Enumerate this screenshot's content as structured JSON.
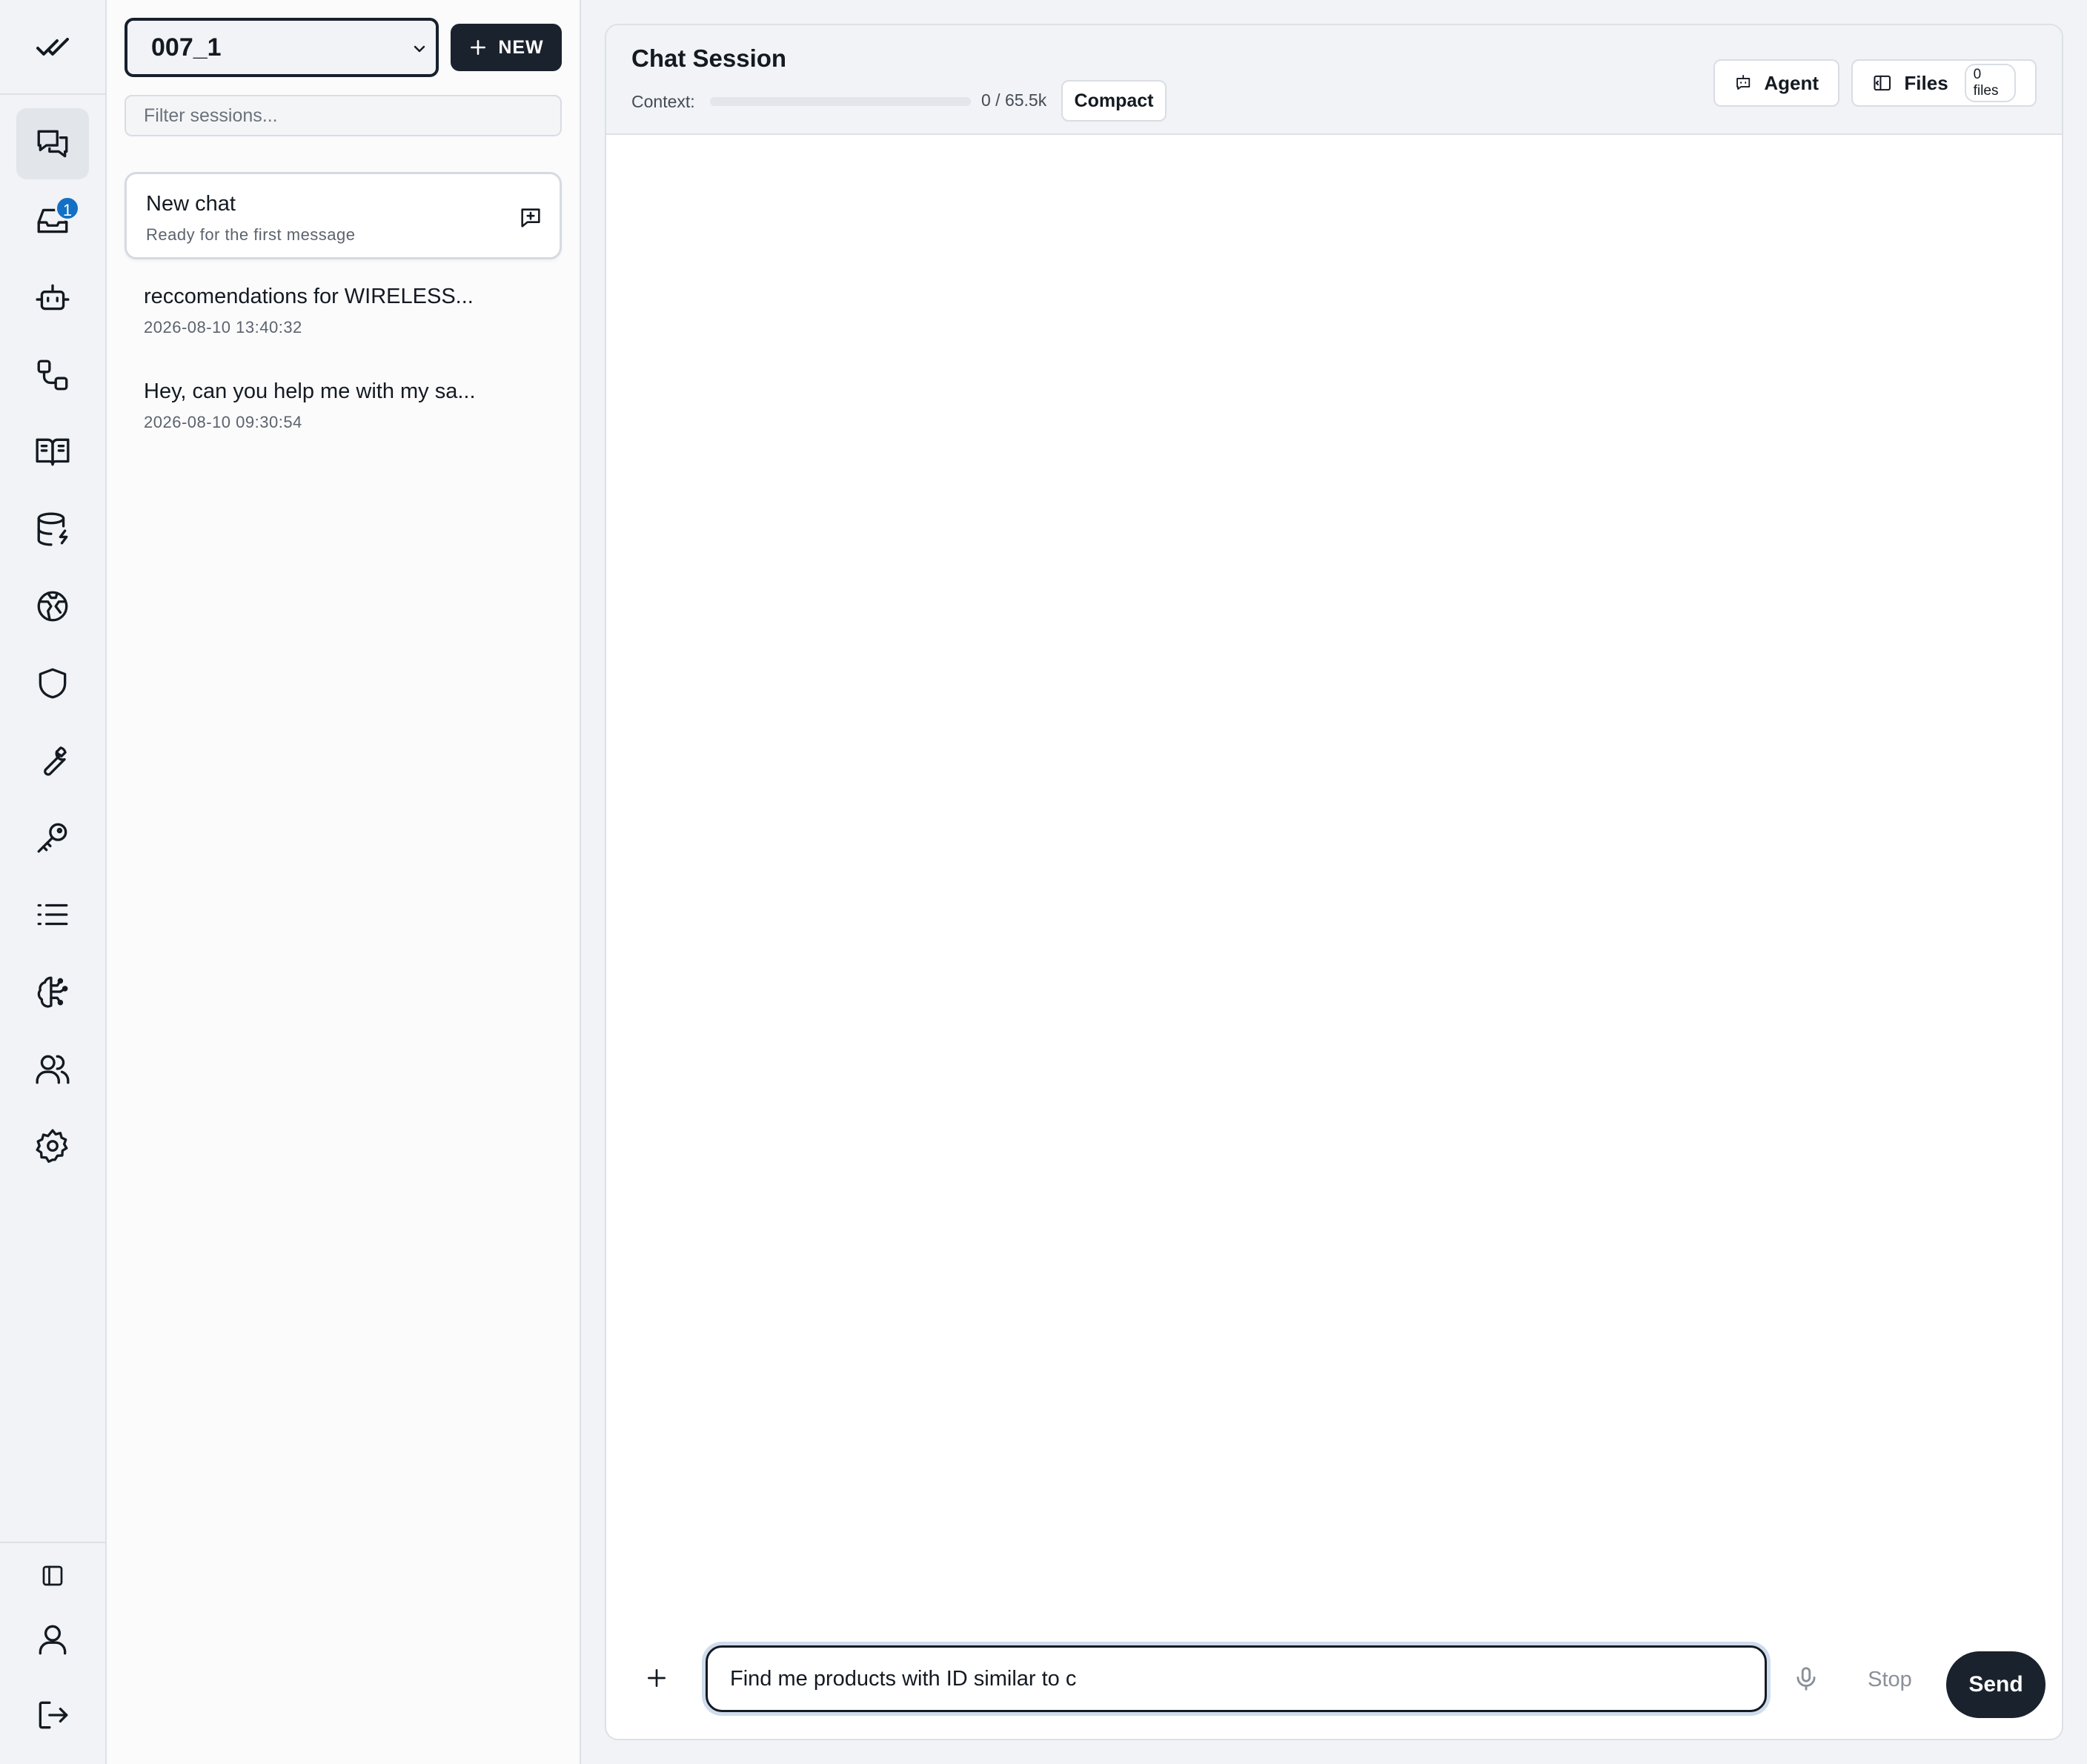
{
  "rail": {
    "logo": "double-check-icon",
    "items": [
      {
        "name": "chat-icon",
        "active": true
      },
      {
        "name": "inbox-icon",
        "badge": "1"
      },
      {
        "name": "bot-icon"
      },
      {
        "name": "workflow-icon"
      },
      {
        "name": "book-icon"
      },
      {
        "name": "database-icon"
      },
      {
        "name": "globe-icon"
      },
      {
        "name": "shield-icon"
      },
      {
        "name": "wrench-icon"
      },
      {
        "name": "key-icon"
      },
      {
        "name": "list-icon"
      },
      {
        "name": "brain-icon"
      },
      {
        "name": "users-icon"
      },
      {
        "name": "gear-icon"
      }
    ],
    "bottom": [
      "sidebar-toggle-icon",
      "user-icon",
      "logout-icon"
    ]
  },
  "sessions": {
    "workspace": "007_1",
    "new_label": "NEW",
    "filter_placeholder": "Filter sessions...",
    "items": [
      {
        "title": "New chat",
        "subtitle": "Ready for the first message",
        "active": true
      },
      {
        "title": "reccomendations for WIRELESS...",
        "subtitle": "2026-08-10 13:40:32"
      },
      {
        "title": "Hey, can you help me with my sa...",
        "subtitle": "2026-08-10 09:30:54"
      }
    ]
  },
  "chat": {
    "title": "Chat Session",
    "context_label": "Context:",
    "context_value": "0 / 65.5k",
    "context_fraction": 0,
    "compact_label": "Compact",
    "agent_label": "Agent",
    "files_label": "Files",
    "files_count": "0 files"
  },
  "composer": {
    "value": "Find me products with ID similar to c",
    "stop_label": "Stop",
    "send_label": "Send"
  },
  "colors": {
    "accent": "#1370c4",
    "dark": "#1a222d",
    "background": "#f1f3f6"
  }
}
